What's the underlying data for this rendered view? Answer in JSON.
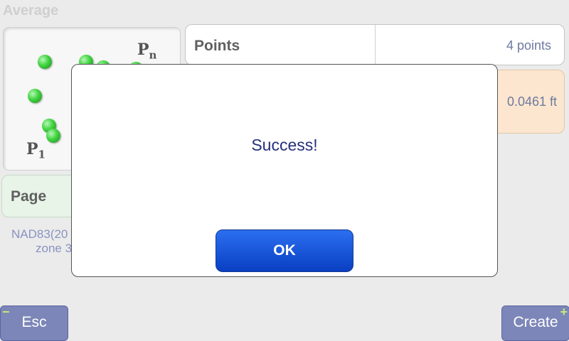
{
  "screen": {
    "title": "Average"
  },
  "points_panel": {
    "p_start": "P",
    "p_start_sub": "1",
    "p_end": "P",
    "p_end_sub": "n"
  },
  "rows": {
    "points": {
      "label": "Points",
      "value": "4 points"
    },
    "precision": {
      "label": "",
      "value": "0.0461 ft"
    }
  },
  "page": {
    "label": "Page"
  },
  "coordinate_system": {
    "line1": "NAD83(20",
    "line2": "zone 3"
  },
  "buttons": {
    "esc": "Esc",
    "create": "Create"
  },
  "dialog": {
    "message": "Success!",
    "ok": "OK"
  },
  "colors": {
    "ok_button": "#1555e0",
    "precision_row": "#fde6cf",
    "page_row": "#e8f4e8"
  }
}
